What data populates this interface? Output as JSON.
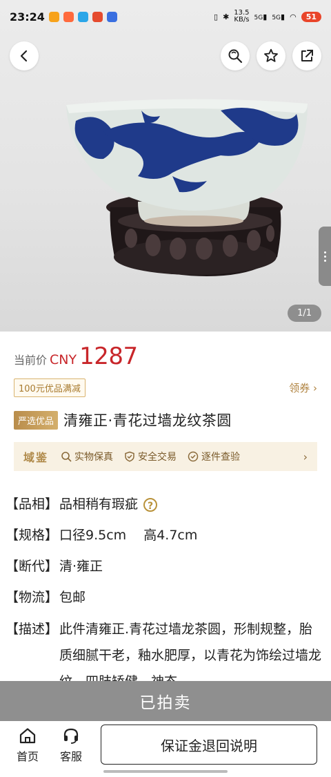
{
  "status_bar": {
    "time": "23:24",
    "net_speed_top": "13.5",
    "net_speed_bottom": "KB/s",
    "signal_1": "5G",
    "signal_2": "5G",
    "battery": "51"
  },
  "hero": {
    "image_counter": "1/1"
  },
  "price": {
    "label": "当前价",
    "currency": "CNY",
    "value": "1287"
  },
  "coupon": {
    "tag": "100元优品满减",
    "link": "领券 ›"
  },
  "product": {
    "badge": "严选优品",
    "title": "清雍正·青花过墙龙纹茶圆"
  },
  "assurance": {
    "brand": "域鉴",
    "items": [
      "实物保真",
      "安全交易",
      "逐件查验"
    ],
    "arrow": "›"
  },
  "info": {
    "condition_key": "【品相】",
    "condition_val": "品相稍有瑕疵",
    "help": "?",
    "spec_key": "【规格】",
    "spec_val": "口径9.5cm　 高4.7cm",
    "dating_key": "【断代】",
    "dating_val": "清·雍正",
    "shipping_key": "【物流】",
    "shipping_val": "包邮",
    "desc_key": "【描述】",
    "desc_val": "此件清雍正.青花过墙龙茶圆，形制规整，胎质细腻干老，釉水肥厚，以青花为饰绘过墙龙纹，四肢矫健，神态"
  },
  "sold_bar": {
    "label": "已拍卖"
  },
  "bottom_nav": {
    "home": "首页",
    "service": "客服",
    "deposit_button": "保证金退回说明"
  },
  "colors": {
    "price_red": "#c8262a",
    "gold": "#b08a4a",
    "sold_gray": "#8f8f8f"
  }
}
